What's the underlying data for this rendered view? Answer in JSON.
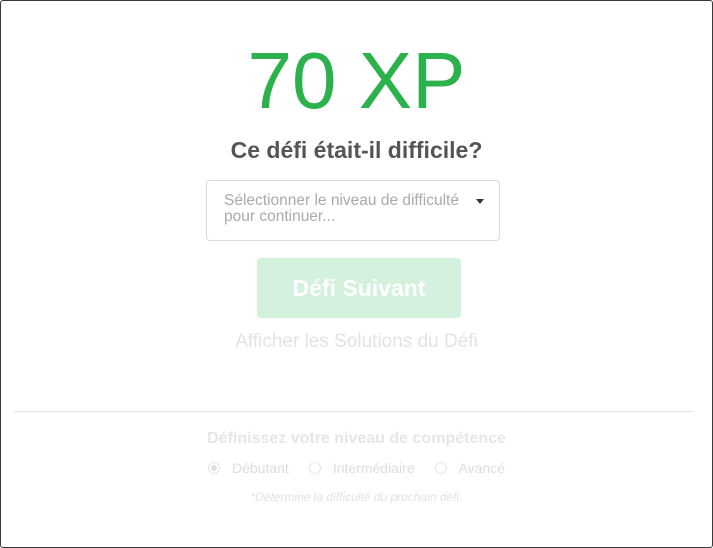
{
  "reward": {
    "xp": "70 XP",
    "color": "#2bb24c"
  },
  "question": "Ce défi était-il difficile?",
  "difficulty_select": {
    "placeholder": "Sélectionner le niveau de difficulté pour continuer..."
  },
  "next_button": {
    "label": "Défi Suivant",
    "state": "disabled"
  },
  "solutions_link": "Afficher les Solutions du Défi",
  "skill": {
    "title": "Définissez votre niveau de compétence",
    "options": [
      {
        "label": "Débutant",
        "selected": true
      },
      {
        "label": "Intermédiaire",
        "selected": false
      },
      {
        "label": "Avancé",
        "selected": false
      }
    ],
    "note": "*Détermine la difficulté du prochain défi."
  }
}
